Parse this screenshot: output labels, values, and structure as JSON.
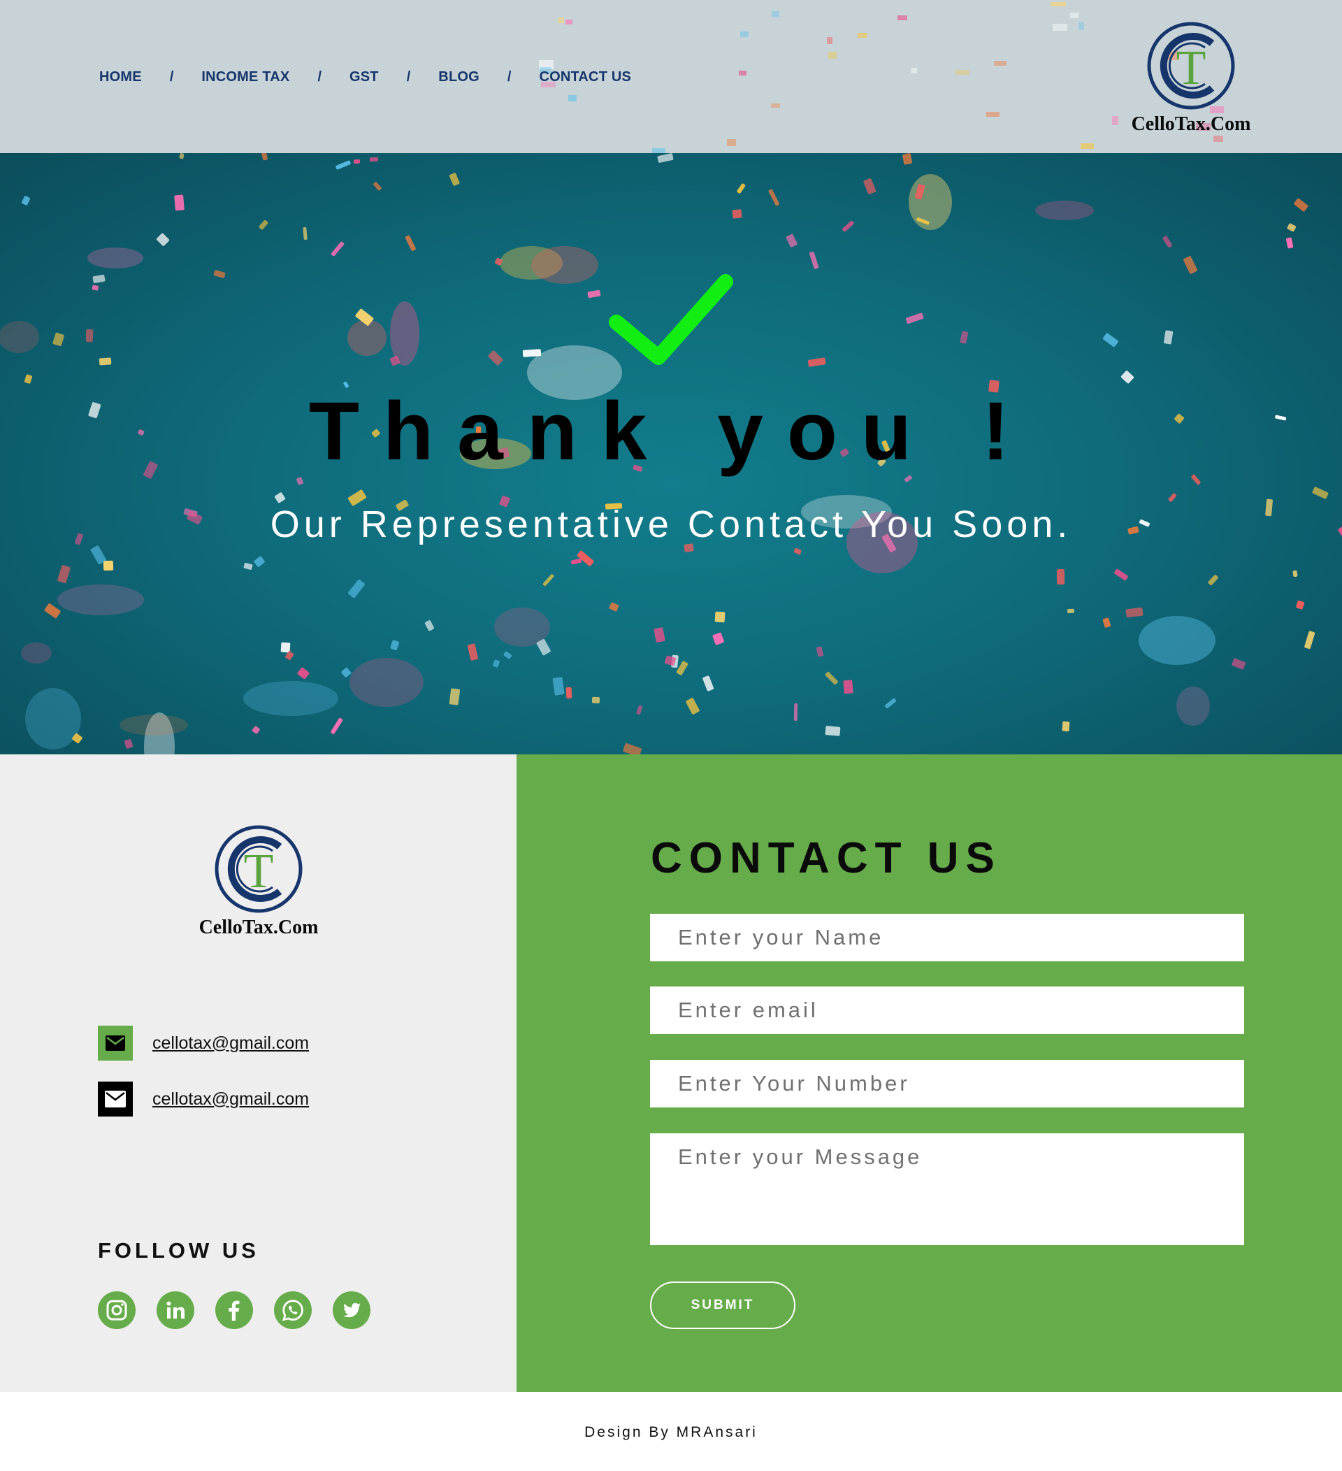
{
  "brand": {
    "name": "CelloTax.Com",
    "monogram_outer": "C",
    "monogram_inner": "T",
    "navy": "#16356b",
    "green": "#5aa33f"
  },
  "nav": {
    "items": [
      {
        "label": "HOME"
      },
      {
        "label": "INCOME TAX"
      },
      {
        "label": "GST"
      },
      {
        "label": "BLOG"
      },
      {
        "label": "CONTACT US"
      }
    ],
    "separator": "/"
  },
  "hero": {
    "heading": "Thank you !",
    "subheading": "Our Representative Contact You Soon.",
    "check_icon": "check-icon",
    "check_color": "#12ee12"
  },
  "contact_info": {
    "items": [
      {
        "icon": "mail-icon",
        "text": "cellotax@gmail.com"
      },
      {
        "icon": "mail-icon",
        "text": "cellotax@gmail.com"
      }
    ]
  },
  "follow": {
    "title": "FOLLOW US",
    "icons": [
      "instagram-icon",
      "linkedin-icon",
      "facebook-icon",
      "whatsapp-icon",
      "twitter-icon"
    ]
  },
  "form": {
    "title": "CONTACT US",
    "name_placeholder": "Enter your Name",
    "email_placeholder": "Enter email",
    "number_placeholder": "Enter Your Number",
    "message_placeholder": "Enter your Message",
    "submit_label": "SUBMIT"
  },
  "footer": {
    "credit": "Design By MRAnsari"
  },
  "colors": {
    "accent_green": "#66ac4a",
    "header_bg": "#c7d3d7",
    "hero_teal": "#127d8c",
    "panel_grey": "#eeeeee"
  }
}
